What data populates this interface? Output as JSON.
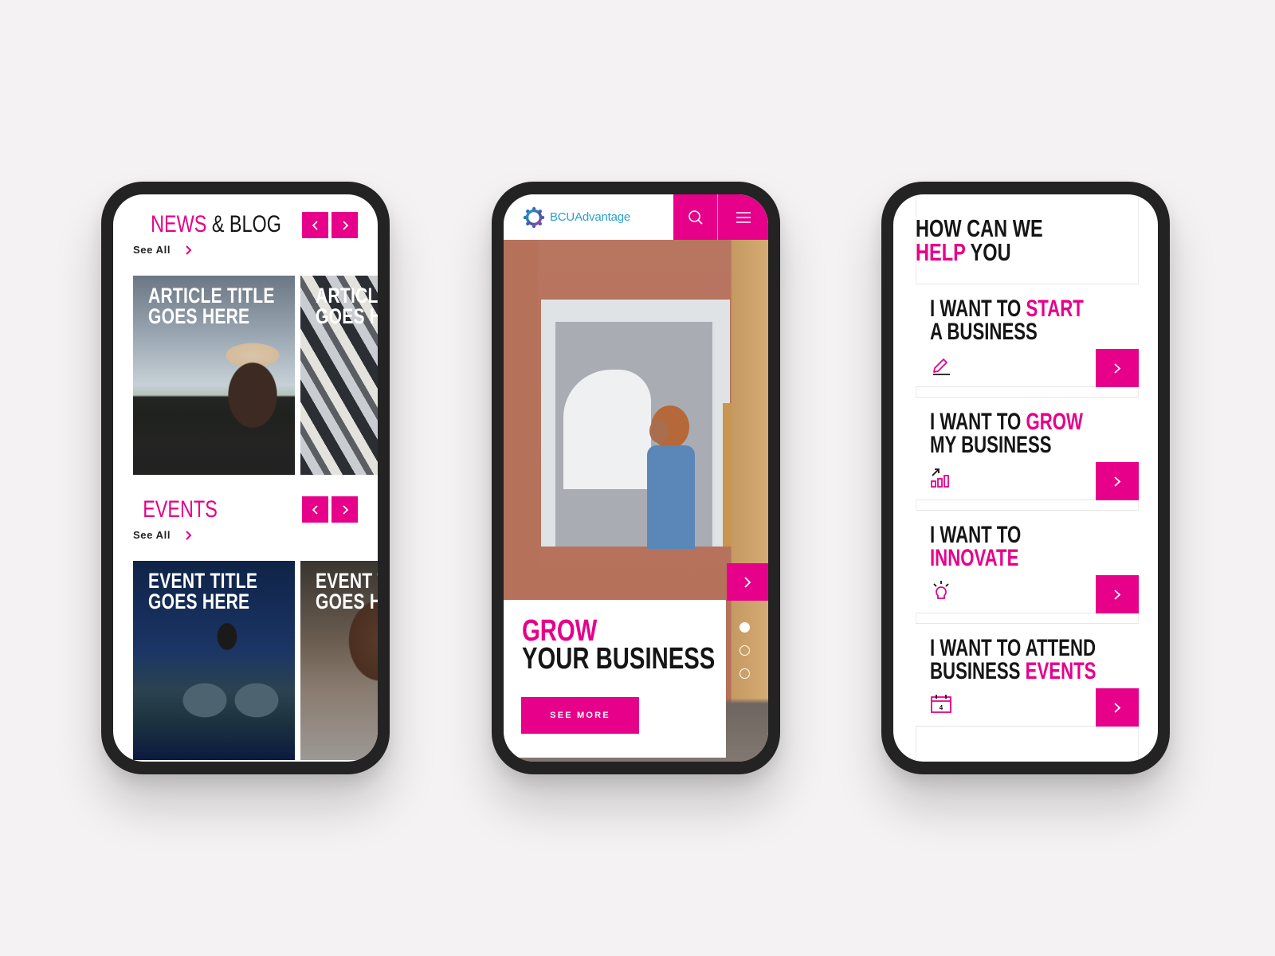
{
  "theme": {
    "accent": "#e6008a",
    "text_dark": "#151515",
    "logo_blue": "#2aa0c8"
  },
  "phone1": {
    "news": {
      "title_highlight": "NEWS",
      "title_rest": "& BLOG",
      "see_all": "See All",
      "prev_icon": "chevron-left-icon",
      "next_icon": "chevron-right-icon",
      "cards": [
        {
          "line1": "ARTICLE TITLE",
          "line2": "GOES HERE"
        },
        {
          "line1": "ARTICLE TITLE",
          "line2": "GOES HERE"
        }
      ]
    },
    "events": {
      "title": "EVENTS",
      "see_all": "See All",
      "cards": [
        {
          "line1": "EVENT TITLE",
          "line2": "GOES HERE"
        },
        {
          "line1": "EVENT TITLE",
          "line2": "GOES HERE"
        }
      ]
    }
  },
  "phone2": {
    "logo_text": "BCUAdvantage",
    "search_icon": "search-icon",
    "menu_icon": "hamburger-menu-icon",
    "hero": {
      "title_highlight": "GROW",
      "title_rest": "YOUR BUSINESS",
      "cta": "SEE MORE",
      "slides_total": 3,
      "active_slide": 1
    }
  },
  "phone3": {
    "heading_line1": "HOW CAN WE",
    "heading_highlight": "HELP",
    "heading_rest": "YOU",
    "cards": [
      {
        "prefix": "I WANT TO",
        "highlight": "START",
        "line2": "A BUSINESS",
        "line2_highlight": "",
        "icon": "pencil-icon"
      },
      {
        "prefix": "I WANT TO",
        "highlight": "GROW",
        "line2": "MY BUSINESS",
        "line2_highlight": "",
        "icon": "growth-chart-icon"
      },
      {
        "prefix": "I WANT TO",
        "highlight": "",
        "line2": "",
        "line2_highlight": "INNOVATE",
        "icon": "lightbulb-icon"
      },
      {
        "prefix": "I WANT TO ATTEND",
        "highlight": "",
        "line2": "BUSINESS",
        "line2_highlight": "EVENTS",
        "icon": "calendar-icon",
        "calendar_day": "4"
      }
    ]
  }
}
